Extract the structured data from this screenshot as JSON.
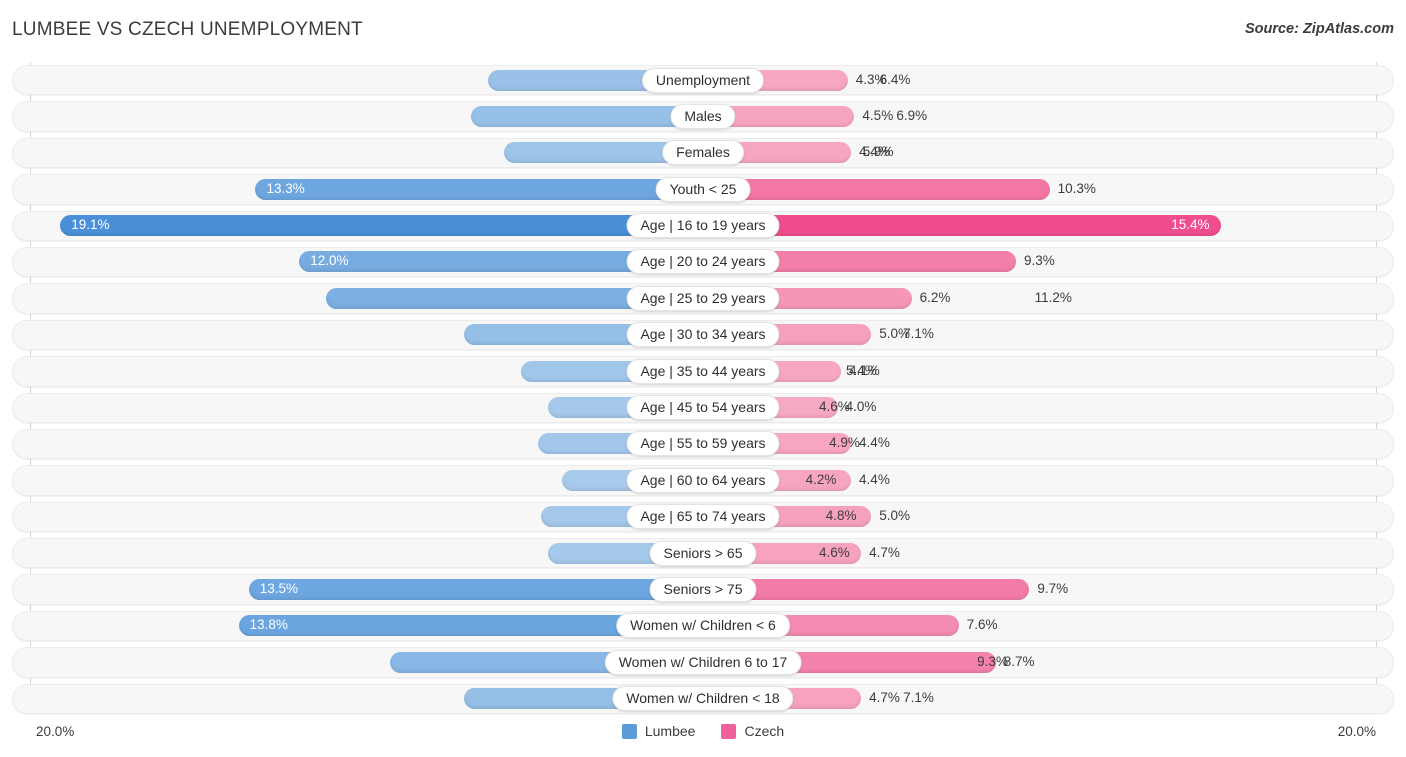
{
  "header": {
    "title": "LUMBEE VS CZECH UNEMPLOYMENT",
    "source": "Source: ZipAtlas.com"
  },
  "axis": {
    "min_label": "20.0%",
    "max_label": "20.0%"
  },
  "legend": {
    "items": [
      {
        "label": "Lumbee",
        "color": "#5b9bd9"
      },
      {
        "label": "Czech",
        "color": "#f0609a"
      }
    ]
  },
  "colors": {
    "lumbee_light": "#a9cbeb",
    "lumbee_mid": "#8cb8e3",
    "lumbee_dark": "#4a90d9",
    "czech_light": "#f7a8c4",
    "czech_mid": "#f485ae",
    "czech_dark": "#ef4d8c",
    "track_bg": "#f7f7f7",
    "axis": "#d5d5d5",
    "text": "#3c3c3c"
  },
  "chart_data": {
    "type": "bar",
    "subtype": "diverging-butterfly",
    "title": "LUMBEE VS CZECH UNEMPLOYMENT",
    "xlabel": "",
    "ylabel": "",
    "xlim": [
      20.0,
      20.0
    ],
    "axis_left_max": 20.0,
    "axis_right_max": 20.0,
    "grid": false,
    "legend_position": "bottom-center",
    "unit": "%",
    "categories": [
      "Unemployment",
      "Males",
      "Females",
      "Youth < 25",
      "Age | 16 to 19 years",
      "Age | 20 to 24 years",
      "Age | 25 to 29 years",
      "Age | 30 to 34 years",
      "Age | 35 to 44 years",
      "Age | 45 to 54 years",
      "Age | 55 to 59 years",
      "Age | 60 to 64 years",
      "Age | 65 to 74 years",
      "Seniors > 65",
      "Seniors > 75",
      "Women w/ Children < 6",
      "Women w/ Children 6 to 17",
      "Women w/ Children < 18"
    ],
    "series": [
      {
        "name": "Lumbee",
        "side": "left",
        "color": "#5b9bd9",
        "values": [
          6.4,
          6.9,
          5.9,
          13.3,
          19.1,
          12.0,
          11.2,
          7.1,
          5.4,
          4.6,
          4.9,
          4.2,
          4.8,
          4.6,
          13.5,
          13.8,
          9.3,
          7.1
        ],
        "labels": [
          "6.4%",
          "6.9%",
          "5.9%",
          "13.3%",
          "19.1%",
          "12.0%",
          "11.2%",
          "7.1%",
          "5.4%",
          "4.6%",
          "4.9%",
          "4.2%",
          "4.8%",
          "4.6%",
          "13.5%",
          "13.8%",
          "9.3%",
          "7.1%"
        ]
      },
      {
        "name": "Czech",
        "side": "right",
        "color": "#f0609a",
        "values": [
          4.3,
          4.5,
          4.4,
          10.3,
          15.4,
          9.3,
          6.2,
          5.0,
          4.1,
          4.0,
          4.4,
          4.4,
          5.0,
          4.7,
          9.7,
          7.6,
          8.7,
          4.7
        ],
        "labels": [
          "4.3%",
          "4.5%",
          "4.4%",
          "10.3%",
          "15.4%",
          "9.3%",
          "6.2%",
          "5.0%",
          "4.1%",
          "4.0%",
          "4.4%",
          "4.4%",
          "5.0%",
          "4.7%",
          "9.7%",
          "7.6%",
          "8.7%",
          "4.7%"
        ]
      }
    ]
  }
}
